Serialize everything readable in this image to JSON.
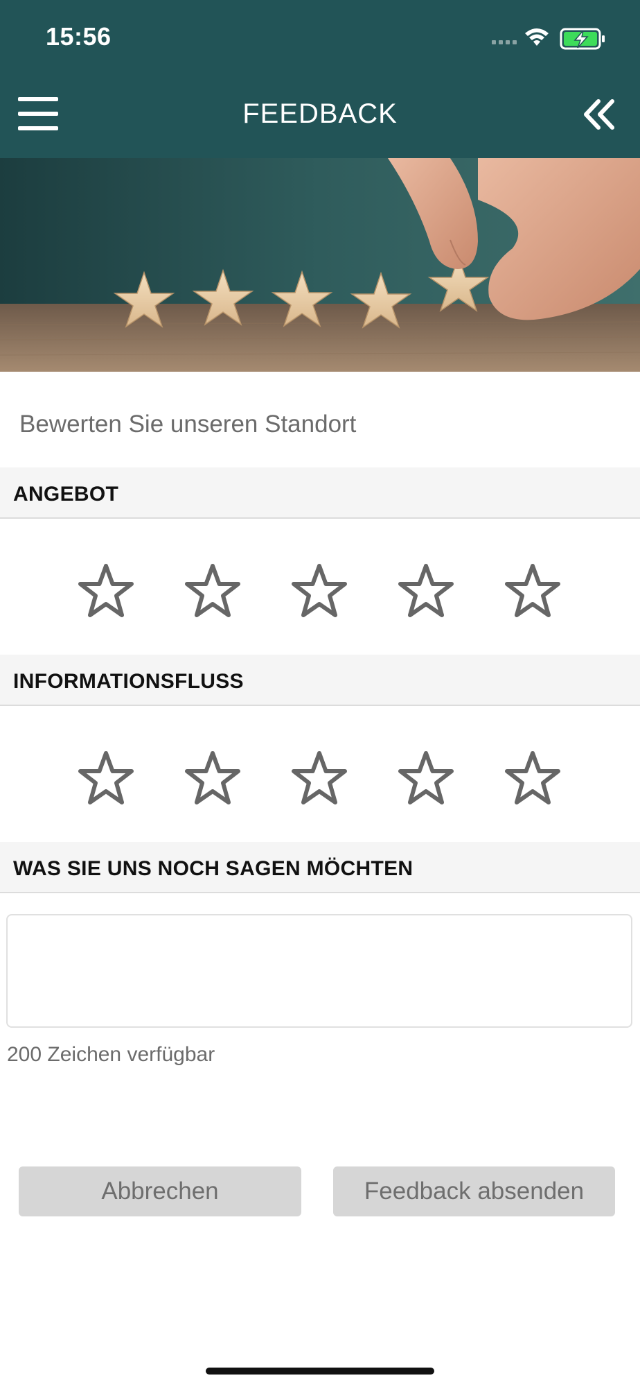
{
  "status_bar": {
    "time": "15:56"
  },
  "header": {
    "title": "FEEDBACK",
    "menu_icon": "hamburger-menu-icon",
    "back_icon": "double-chevron-left-icon",
    "background_color": "#225457"
  },
  "hero_image": {
    "description_icon": "five-wooden-stars-photo"
  },
  "intro_text": "Bewerten Sie unseren Standort",
  "sections": [
    {
      "title": "ANGEBOT",
      "rating": 0,
      "max_rating": 5
    },
    {
      "title": "INFORMATIONSFLUSS",
      "rating": 0,
      "max_rating": 5
    },
    {
      "title": "WAS SIE UNS NOCH SAGEN MÖCHTEN"
    }
  ],
  "comment": {
    "value": "",
    "placeholder": "",
    "counter_text": "200 Zeichen verfügbar"
  },
  "buttons": {
    "cancel_label": "Abbrechen",
    "submit_label": "Feedback absenden"
  },
  "colors": {
    "star_outline": "#666666",
    "button_bg": "#d6d6d6",
    "section_bg": "#f5f5f5"
  }
}
